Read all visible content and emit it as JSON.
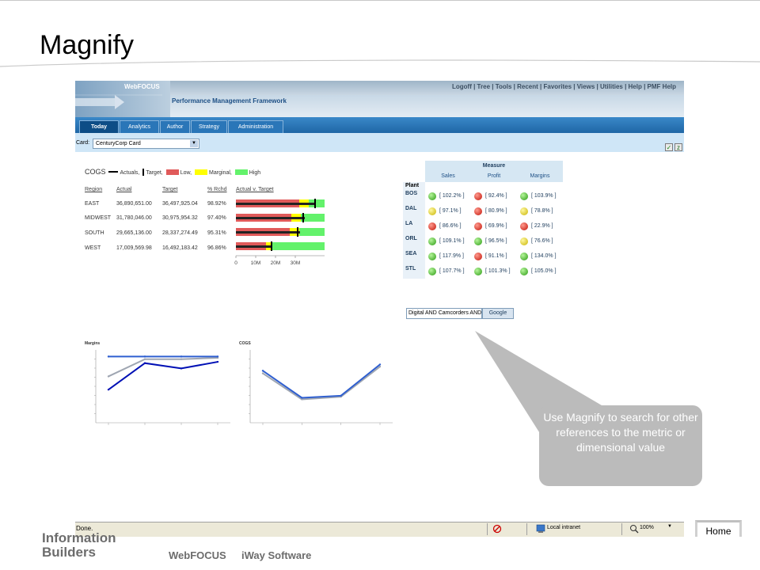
{
  "slide": {
    "title": "Magnify",
    "callout": "Use Magnify to search for other references to the metric or dimensional value",
    "home_label": "Home",
    "footer": {
      "logo_line1": "Information",
      "logo_line2": "Builders",
      "links": [
        "WebFOCUS",
        "iWay Software"
      ]
    }
  },
  "browser": {
    "brand": "WebFOCUS",
    "top_links": "Logoff | Tree | Tools | Recent | Favorites | Views | Utilities | Help | PMF Help",
    "pmf_title": "Performance Management Framework",
    "tabs": [
      "Today",
      "Analytics",
      "Author",
      "Strategy",
      "Administration"
    ],
    "active_tab": "Today",
    "card_label": "Card:",
    "card_value": "CenturyCorp Card",
    "status": {
      "done": "Done.",
      "zone": "Local intranet",
      "zoom": "100%"
    }
  },
  "cogs": {
    "legend": {
      "title": "COGS",
      "actuals": "Actuals,",
      "target": "Target,",
      "low": "Low,",
      "marginal": "Marginal,",
      "high": "High"
    },
    "colors": {
      "low": "#e05a5a",
      "marginal": "#ffff00",
      "high": "#63f26b"
    },
    "headers": [
      "Region",
      "Actual",
      "Target",
      "% Rchd",
      "Actual v. Target"
    ],
    "rows": [
      {
        "region": "EAST",
        "actual": "36,890,651.00",
        "target": "36,497,925.04",
        "rchd": "98.92%"
      },
      {
        "region": "MIDWEST",
        "actual": "31,780,046.00",
        "target": "30,975,954.32",
        "rchd": "97.40%"
      },
      {
        "region": "SOUTH",
        "actual": "29,665,136.00",
        "target": "28,337,274.49",
        "rchd": "95.31%"
      },
      {
        "region": "WEST",
        "actual": "17,009,569.98",
        "target": "16,492,183.42",
        "rchd": "96.86%"
      }
    ],
    "axis_ticks": [
      "0",
      "10M",
      "20M",
      "30M"
    ]
  },
  "measure": {
    "title": "Measure",
    "columns": [
      "Sales",
      "Profit",
      "Margins"
    ],
    "row_header": "Plant",
    "rows": [
      {
        "plant": "BOS",
        "cells": [
          {
            "v": "[ 102.2% ]",
            "s": "green"
          },
          {
            "v": "[ 92.4% ]",
            "s": "red"
          },
          {
            "v": "[ 103.9% ]",
            "s": "green"
          }
        ]
      },
      {
        "plant": "DAL",
        "cells": [
          {
            "v": "[ 97.1% ]",
            "s": "yellow"
          },
          {
            "v": "[ 80.9% ]",
            "s": "red"
          },
          {
            "v": "[ 78.8% ]",
            "s": "yellow"
          }
        ]
      },
      {
        "plant": "LA",
        "cells": [
          {
            "v": "[ 86.6% ]",
            "s": "red"
          },
          {
            "v": "[ 69.9% ]",
            "s": "red"
          },
          {
            "v": "[ 22.9% ]",
            "s": "red"
          }
        ]
      },
      {
        "plant": "ORL",
        "cells": [
          {
            "v": "[ 109.1% ]",
            "s": "green"
          },
          {
            "v": "[ 96.5% ]",
            "s": "green"
          },
          {
            "v": "[ 76.6% ]",
            "s": "yellow"
          }
        ]
      },
      {
        "plant": "SEA",
        "cells": [
          {
            "v": "[ 117.9% ]",
            "s": "green"
          },
          {
            "v": "[ 91.1% ]",
            "s": "red"
          },
          {
            "v": "[ 134.0% ]",
            "s": "green"
          }
        ]
      },
      {
        "plant": "STL",
        "cells": [
          {
            "v": "[ 107.7% ]",
            "s": "green"
          },
          {
            "v": "[ 101.3% ]",
            "s": "green"
          },
          {
            "v": "[ 105.0% ]",
            "s": "green"
          }
        ]
      }
    ]
  },
  "search": {
    "value": "Digital AND Camcorders AND",
    "button": "Google"
  },
  "chart_data": [
    {
      "type": "line",
      "title": "Margins",
      "series": [
        {
          "values": [
            0.35,
            0.48,
            0.48,
            0.49
          ],
          "color": "#9fa6b2"
        },
        {
          "values": [
            0.5,
            0.5,
            0.5,
            0.5
          ],
          "color": "#2f5fd0"
        },
        {
          "values": [
            0.25,
            0.45,
            0.41,
            0.46
          ],
          "color": "#0010b5"
        }
      ],
      "ylim": [
        0,
        0.55
      ]
    },
    {
      "type": "line",
      "title": "COGS",
      "series": [
        {
          "values": [
            95000,
            45000,
            50000,
            108000
          ],
          "color": "#9fa6b2"
        },
        {
          "values": [
            100000,
            48000,
            52000,
            112000
          ],
          "color": "#2f5fd0"
        }
      ],
      "ylim": [
        0,
        140000
      ]
    }
  ]
}
